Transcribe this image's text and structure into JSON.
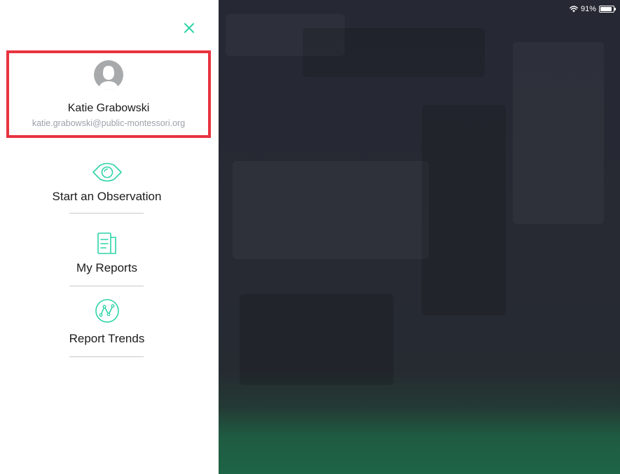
{
  "colors": {
    "accent": "#2fd3a8",
    "highlight_border": "#e8343f",
    "name_text": "#1a1a1a",
    "email_text": "#9ca1a8",
    "background_panel": "#262833"
  },
  "sidebar": {
    "close_icon": "close-icon",
    "profile": {
      "avatar_icon": "avatar-placeholder-icon",
      "name": "Katie Grabowski",
      "email": "katie.grabowski@public-montessori.org"
    },
    "menu": [
      {
        "id": "start-observation",
        "label": "Start an Observation",
        "icon": "eye-icon"
      },
      {
        "id": "my-reports",
        "label": "My Reports",
        "icon": "document-icon"
      },
      {
        "id": "report-trends",
        "label": "Report Trends",
        "icon": "trend-line-icon"
      }
    ]
  },
  "status_bar": {
    "battery_text": "91%",
    "battery_level": 0.91,
    "wifi_icon": "wifi-icon",
    "battery_icon": "battery-icon"
  }
}
